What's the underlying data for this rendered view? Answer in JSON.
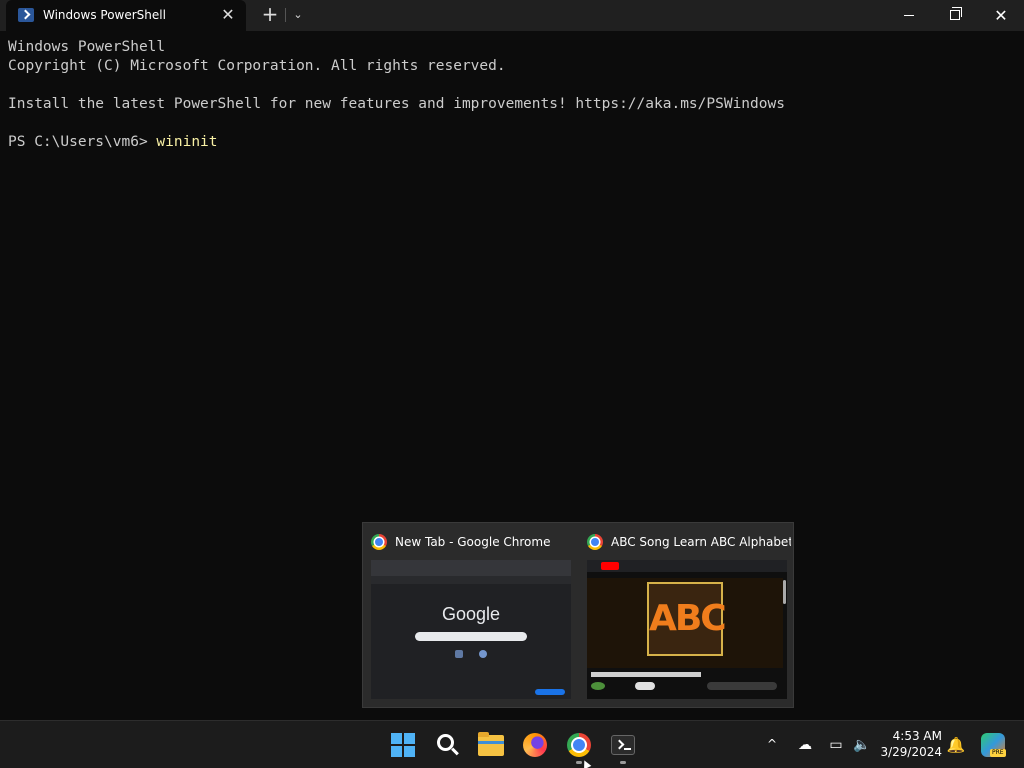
{
  "window": {
    "tab_title": "Windows PowerShell",
    "tab_close": "✕",
    "new_tab": "+",
    "tab_dropdown": "⌄",
    "close": "✕"
  },
  "terminal": {
    "lines": [
      "Windows PowerShell",
      "Copyright (C) Microsoft Corporation. All rights reserved.",
      "",
      "Install the latest PowerShell for new features and improvements! https://aka.ms/PSWindows",
      ""
    ],
    "prompt": "PS C:\\Users\\vm6> ",
    "command": "wininit"
  },
  "thumbnails": [
    {
      "title": "New Tab - Google Chrome",
      "preview_text": "Google"
    },
    {
      "title": "ABC Song Learn ABC Alphabet ...",
      "preview_text": "ABC"
    }
  ],
  "taskbar": {
    "apps": [
      "start-icon",
      "search-icon",
      "file-explorer-icon",
      "firefox-icon",
      "chrome-icon",
      "terminal-icon"
    ],
    "tray_chevron": "^",
    "time": "4:53 AM",
    "date": "3/29/2024",
    "copilot_badge": "PRE"
  },
  "colors": {
    "terminal_bg": "#0c0c0c",
    "command_color": "#f9f1a5",
    "accent": "#4fb3f6"
  }
}
